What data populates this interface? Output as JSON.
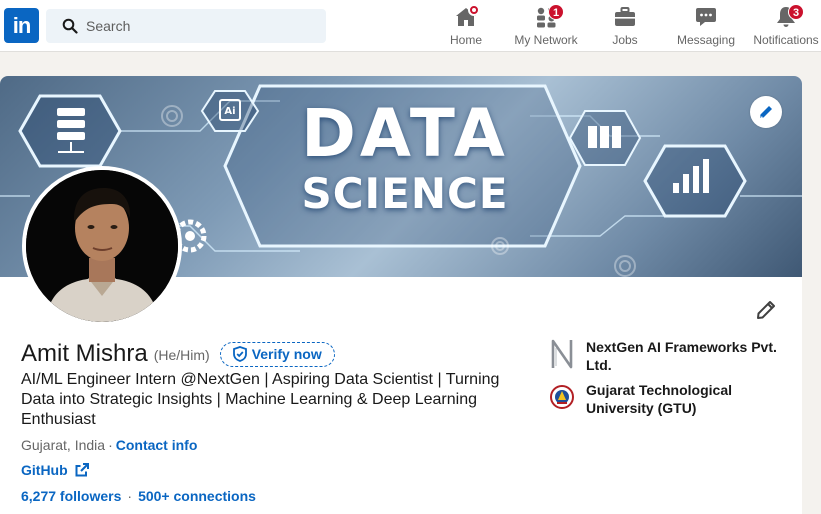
{
  "header": {
    "logo_text": "in",
    "search_placeholder": "Search",
    "nav": [
      {
        "label": "Home",
        "icon": "home-icon",
        "badge": "",
        "dot": true
      },
      {
        "label": "My Network",
        "icon": "network-icon",
        "badge": "1"
      },
      {
        "label": "Jobs",
        "icon": "briefcase-icon",
        "badge": ""
      },
      {
        "label": "Messaging",
        "icon": "message-icon",
        "badge": ""
      },
      {
        "label": "Notifications",
        "icon": "bell-icon",
        "badge": "3"
      }
    ]
  },
  "banner": {
    "line1": "DATA",
    "line2": "SCIENCE"
  },
  "profile": {
    "name": "Amit Mishra",
    "pronouns": "(He/Him)",
    "verify_label": "Verify now",
    "headline": "AI/ML Engineer Intern @NextGen | Aspiring Data Scientist | Turning Data into Strategic Insights | Machine Learning & Deep Learning Enthusiast",
    "location": "Gujarat, India",
    "contact_label": "Contact info",
    "website_label": "GitHub",
    "followers": "6,277 followers",
    "connections": "500+ connections"
  },
  "side": {
    "company": "NextGen AI Frameworks Pvt. Ltd.",
    "school": "Gujarat Technological University (GTU)"
  },
  "colors": {
    "brand": "#0a66c2",
    "badge": "#cb112d",
    "background": "#f4f2ee"
  }
}
